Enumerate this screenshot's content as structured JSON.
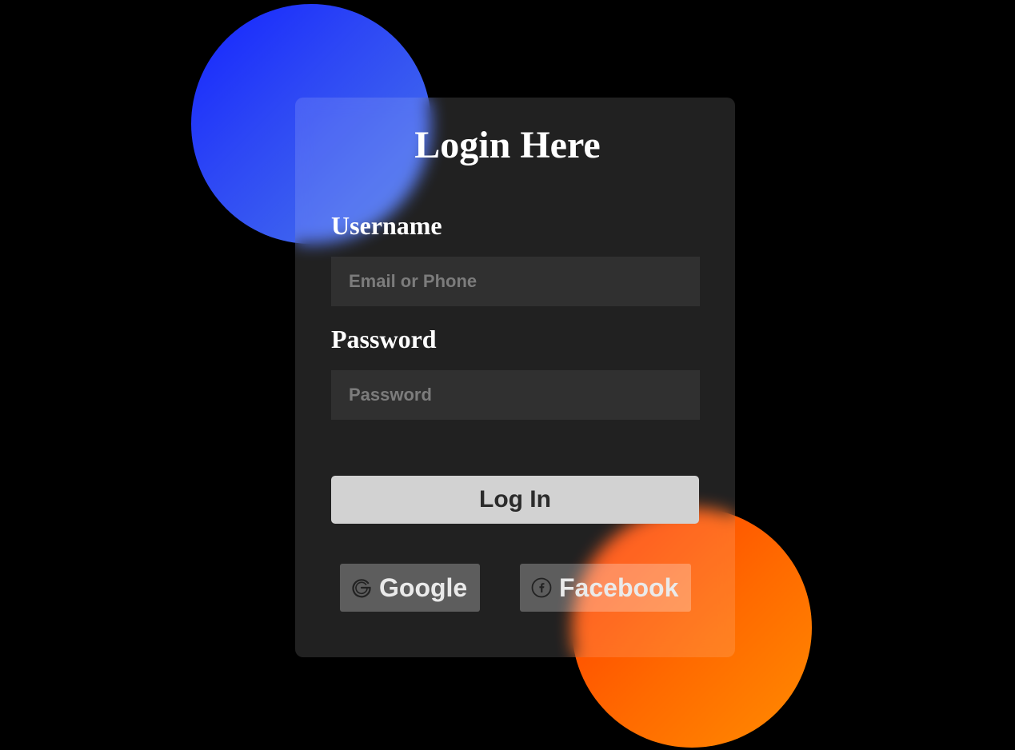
{
  "form": {
    "title": "Login Here",
    "username": {
      "label": "Username",
      "placeholder": "Email or Phone",
      "value": ""
    },
    "password": {
      "label": "Password",
      "placeholder": "Password",
      "value": ""
    },
    "submit_label": "Log In",
    "social": [
      {
        "label": "Google",
        "icon": "google-icon"
      },
      {
        "label": "Facebook",
        "icon": "facebook-icon"
      }
    ]
  },
  "colors": {
    "background": "#000000",
    "card": "rgba(255,255,255,0.13)",
    "button": "#d2d2d2",
    "blue_circle": [
      "#1424ff",
      "#4a78ea"
    ],
    "orange_circle": [
      "#ff3a00",
      "#ff8c00"
    ]
  }
}
